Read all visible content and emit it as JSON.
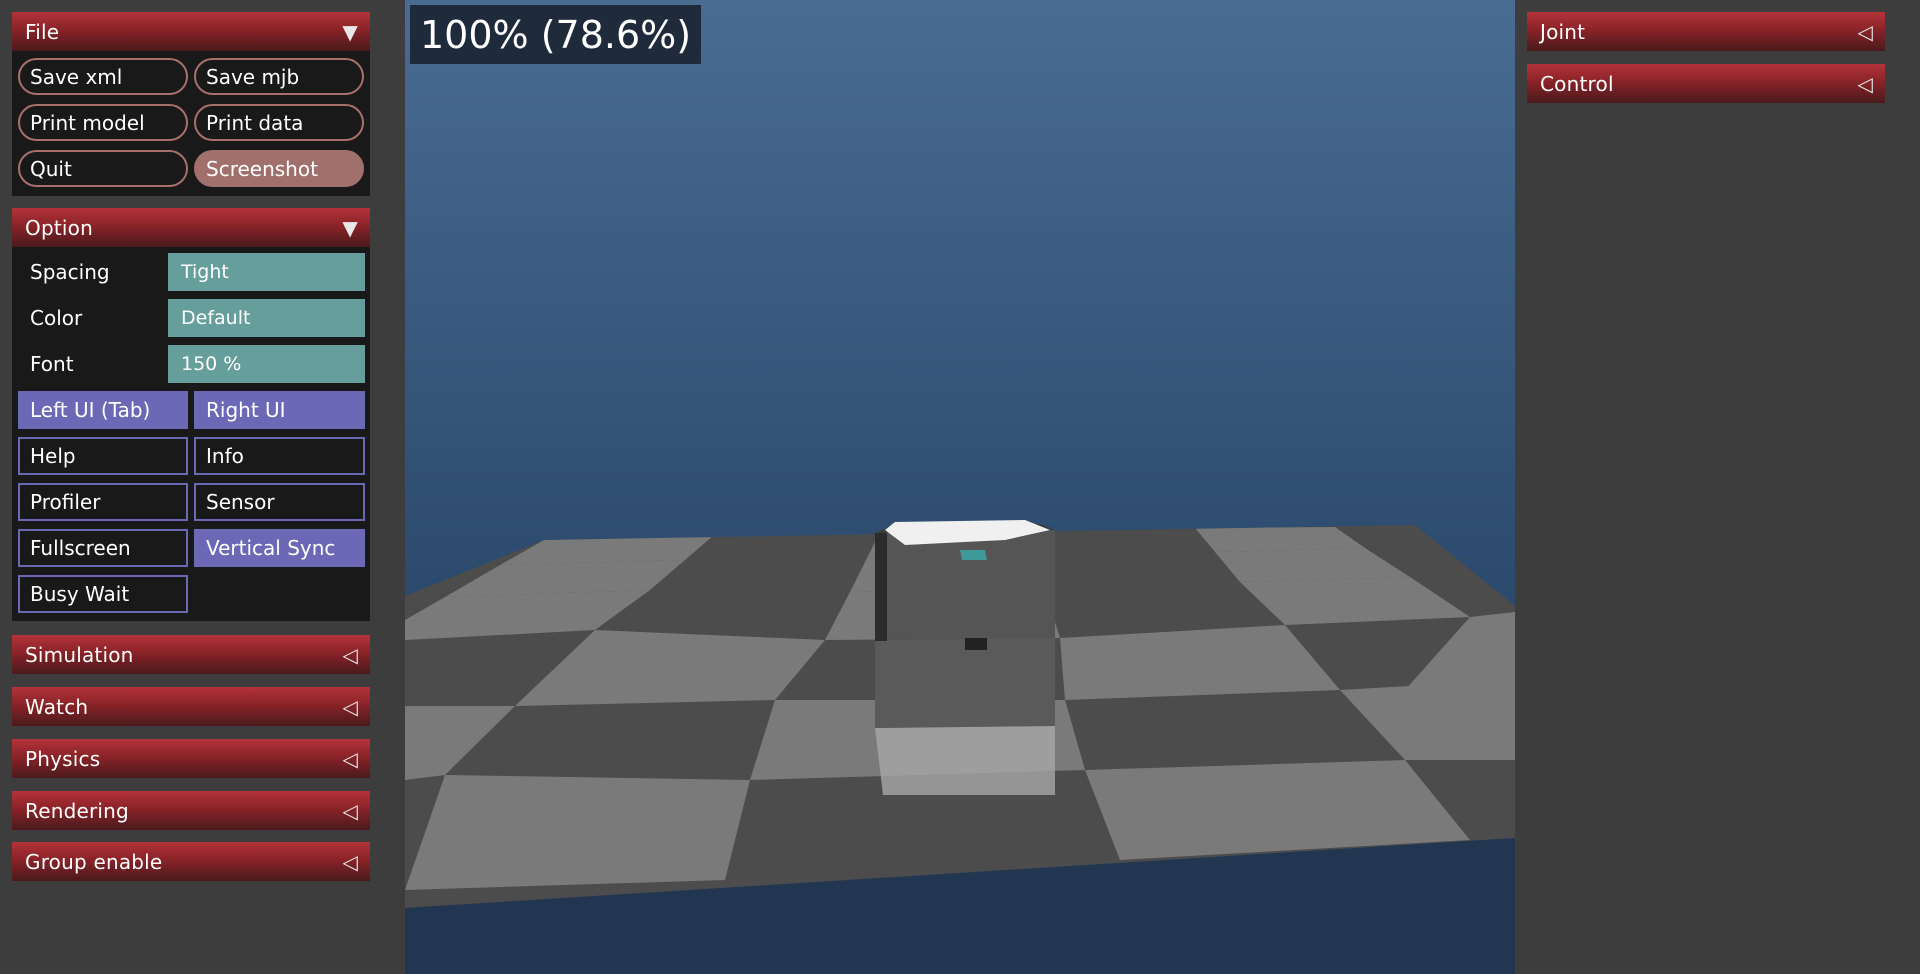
{
  "fps_overlay": "100% (78.6%)",
  "left_panel": {
    "file": {
      "title": "File",
      "buttons": {
        "save_xml": "Save xml",
        "save_mjb": "Save mjb",
        "print_model": "Print model",
        "print_data": "Print data",
        "quit": "Quit",
        "screenshot": "Screenshot"
      }
    },
    "option": {
      "title": "Option",
      "spacing_label": "Spacing",
      "spacing_value": "Tight",
      "color_label": "Color",
      "color_value": "Default",
      "font_label": "Font",
      "font_value": "150 %",
      "toggles": {
        "left_ui": "Left UI (Tab)",
        "right_ui": "Right UI",
        "help": "Help",
        "info": "Info",
        "profiler": "Profiler",
        "sensor": "Sensor",
        "fullscreen": "Fullscreen",
        "vertical_sync": "Vertical Sync",
        "busy_wait": "Busy Wait"
      }
    },
    "collapsed_sections": {
      "simulation": "Simulation",
      "watch": "Watch",
      "physics": "Physics",
      "rendering": "Rendering",
      "group_enable": "Group enable"
    }
  },
  "right_panel": {
    "joint": "Joint",
    "control": "Control"
  },
  "colors": {
    "section_header": "#8a2328",
    "button_border": "#a7706d",
    "select_fill": "#659e9b",
    "toggle_on": "#6b68b6",
    "panel_bg": "#3d3d3d"
  },
  "icons": {
    "expanded": "triangle-down-icon",
    "collapsed": "triangle-left-icon"
  }
}
